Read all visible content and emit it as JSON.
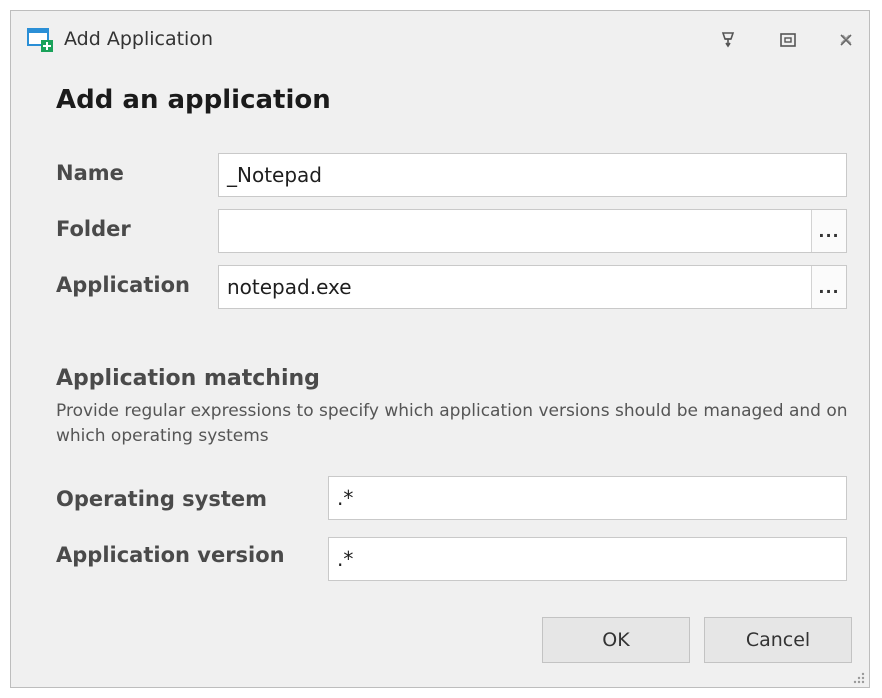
{
  "window": {
    "title": "Add Application",
    "icons": {
      "app": "window-add-icon",
      "help": "help-pin-icon",
      "maximize": "maximize-icon",
      "close": "close-icon"
    }
  },
  "form": {
    "heading": "Add an application",
    "name": {
      "label": "Name",
      "value": "_Notepad"
    },
    "folder": {
      "label": "Folder",
      "value": "",
      "browse_label": "..."
    },
    "application": {
      "label": "Application",
      "value": "notepad.exe",
      "browse_label": "..."
    }
  },
  "matching": {
    "title": "Application matching",
    "description": "Provide regular expressions to specify which application versions should be managed and on which operating systems",
    "operating_system": {
      "label": "Operating system",
      "value": ".*"
    },
    "application_version": {
      "label": "Application version",
      "value": ".*"
    }
  },
  "buttons": {
    "ok": "OK",
    "cancel": "Cancel"
  },
  "colors": {
    "window_bg": "#f0f0f0",
    "icon_accent": "#1aa25a",
    "icon_blue": "#2b8fd6"
  }
}
